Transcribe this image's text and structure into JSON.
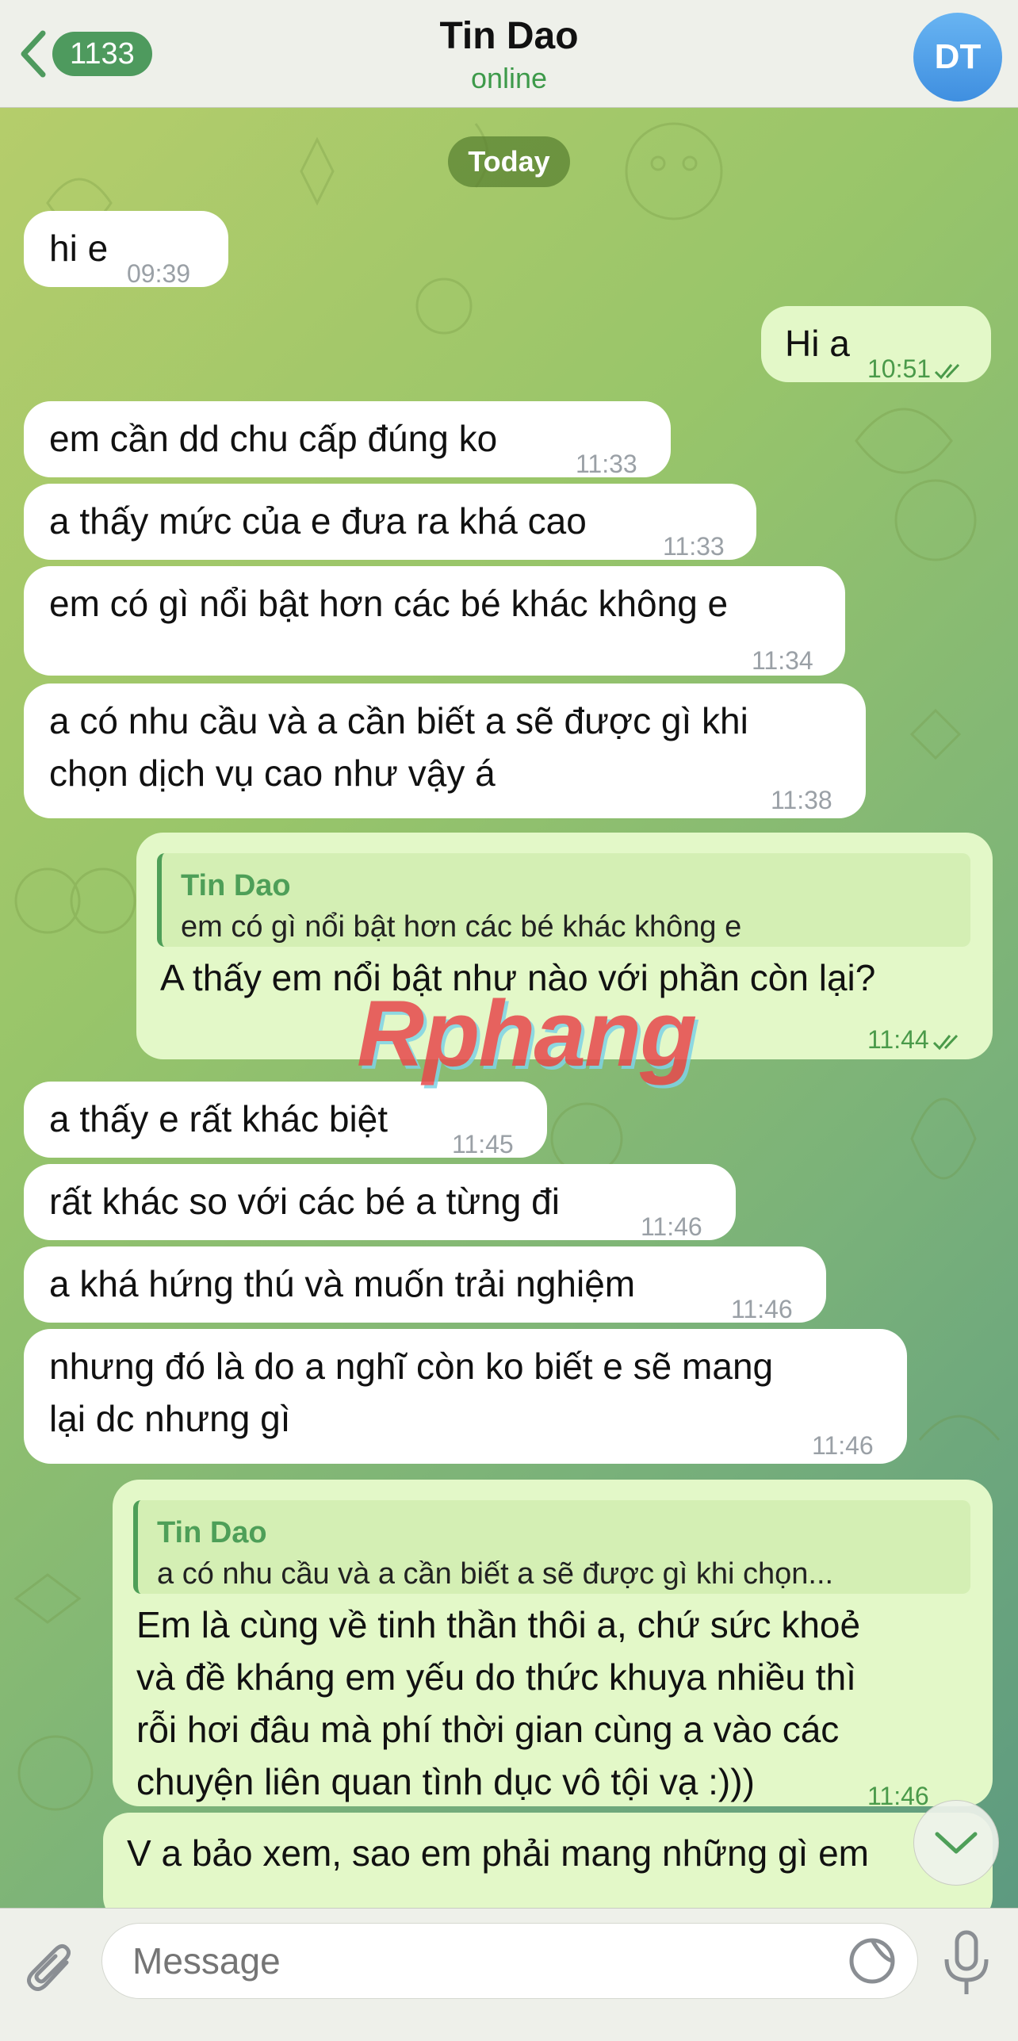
{
  "header": {
    "back_count": "1133",
    "title": "Tin Dao",
    "status": "online",
    "avatar_initials": "DT"
  },
  "chat": {
    "date_label": "Today",
    "messages": [
      {
        "dir": "in",
        "text": "hi e",
        "time": "09:39"
      },
      {
        "dir": "out",
        "text": "Hi a",
        "time": "10:51",
        "status": "read"
      },
      {
        "dir": "in",
        "text": "em cần dd chu cấp đúng ko",
        "time": "11:33"
      },
      {
        "dir": "in",
        "text": "a thấy mức của e đưa ra khá cao",
        "time": "11:33"
      },
      {
        "dir": "in",
        "text": "em có gì nổi bật hơn các bé khác không e",
        "time": "11:34"
      },
      {
        "dir": "in",
        "text_lines": [
          "a có nhu cầu và a cần biết a sẽ được gì khi",
          "chọn dịch vụ cao như vậy á"
        ],
        "time": "11:38"
      },
      {
        "dir": "out",
        "quote": {
          "name": "Tin Dao",
          "text": "em có gì nổi bật hơn các bé khác không e"
        },
        "text": "A thấy em nổi bật như nào với phần còn lại?",
        "time": "11:44",
        "status": "read"
      },
      {
        "dir": "in",
        "text": "a thấy e rất khác biệt",
        "time": "11:45"
      },
      {
        "dir": "in",
        "text": "rất khác so với các bé a từng đi",
        "time": "11:46"
      },
      {
        "dir": "in",
        "text": "a khá hứng thú và muốn trải nghiệm",
        "time": "11:46"
      },
      {
        "dir": "in",
        "text_lines": [
          "nhưng đó là do a nghĩ còn ko biết e sẽ mang",
          "lại dc nhưng gì"
        ],
        "time": "11:46"
      },
      {
        "dir": "out",
        "quote": {
          "name": "Tin Dao",
          "text": "a có nhu cầu và a cần biết a sẽ được gì khi chọn..."
        },
        "text_lines": [
          "Em là cùng về tinh thần thôi a, chứ sức khoẻ",
          "và đề kháng em yếu do thức khuya nhiều thì",
          "rỗi hơi đâu mà phí thời gian cùng a vào các",
          "chuyện liên quan tình dục vô tội vạ :)))"
        ],
        "time": "11:46"
      },
      {
        "dir": "out",
        "text": "V a bảo xem, sao em phải mang những gì em"
      }
    ]
  },
  "watermark": "Rphang",
  "composer": {
    "placeholder": "Message",
    "icons": [
      "paperclip-icon",
      "sticker-icon",
      "microphone-icon"
    ]
  },
  "colors": {
    "accent": "#4e9f58",
    "outgoing_bubble": "#e3f8c8",
    "incoming_bubble": "#ffffff",
    "avatar": "#4a9be8"
  }
}
